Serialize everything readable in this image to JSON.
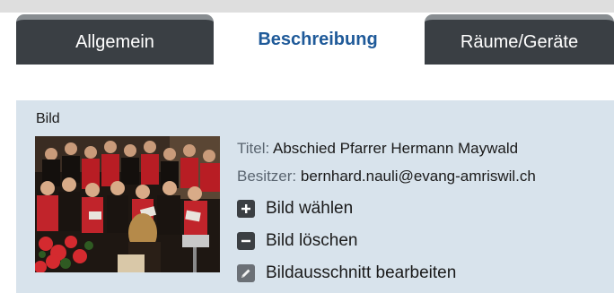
{
  "tabs": [
    {
      "label": "Allgemein",
      "active": false
    },
    {
      "label": "Beschreibung",
      "active": true
    },
    {
      "label": "Räume/Geräte",
      "active": false
    }
  ],
  "image_section": {
    "label": "Bild",
    "title_key": "Titel:",
    "title_value": "Abschied Pfarrer Hermann Maywald",
    "owner_key": "Besitzer:",
    "owner_value": "bernhard.nauli@evang-amriswil.ch",
    "actions": [
      {
        "label": "Bild wählen",
        "icon": "plus-icon"
      },
      {
        "label": "Bild löschen",
        "icon": "minus-icon"
      },
      {
        "label": "Bildausschnitt bearbeiten",
        "icon": "pencil-icon"
      }
    ]
  },
  "colors": {
    "active_tab_text": "#1f5a99",
    "inactive_tab_bg": "#3a3f44",
    "panel_bg": "#d8e3ec"
  }
}
